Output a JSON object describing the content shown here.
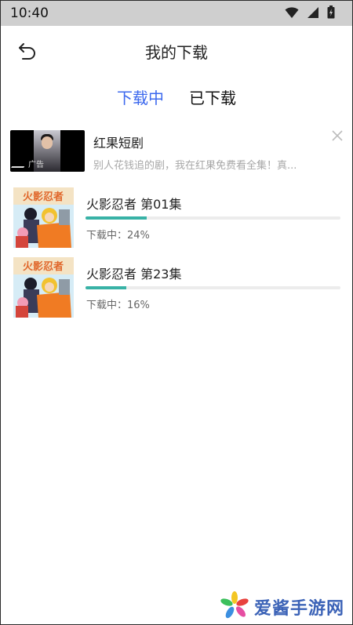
{
  "status_bar": {
    "time": "10:40",
    "icons": [
      "wifi-icon",
      "cellular-icon",
      "battery-icon"
    ]
  },
  "header": {
    "title": "我的下载",
    "back_icon": "back-arrow-icon"
  },
  "tabs": [
    {
      "label": "下载中",
      "active": true
    },
    {
      "label": "已下载",
      "active": false
    }
  ],
  "ad": {
    "title": "红果短剧",
    "description": "别人花钱追的剧，我在红果免费看全集！真...",
    "badge": "广告"
  },
  "downloads": [
    {
      "title": "火影忍者  第01集",
      "status": "下载中：24%",
      "progress": 0.24
    },
    {
      "title": "火影忍者  第23集",
      "status": "下载中：16%",
      "progress": 0.16
    }
  ],
  "watermark": {
    "text": "爱酱手游网"
  },
  "colors": {
    "accent": "#3d69ee",
    "progress": "#38b2a6",
    "statusbar": "#cfcfcf"
  }
}
